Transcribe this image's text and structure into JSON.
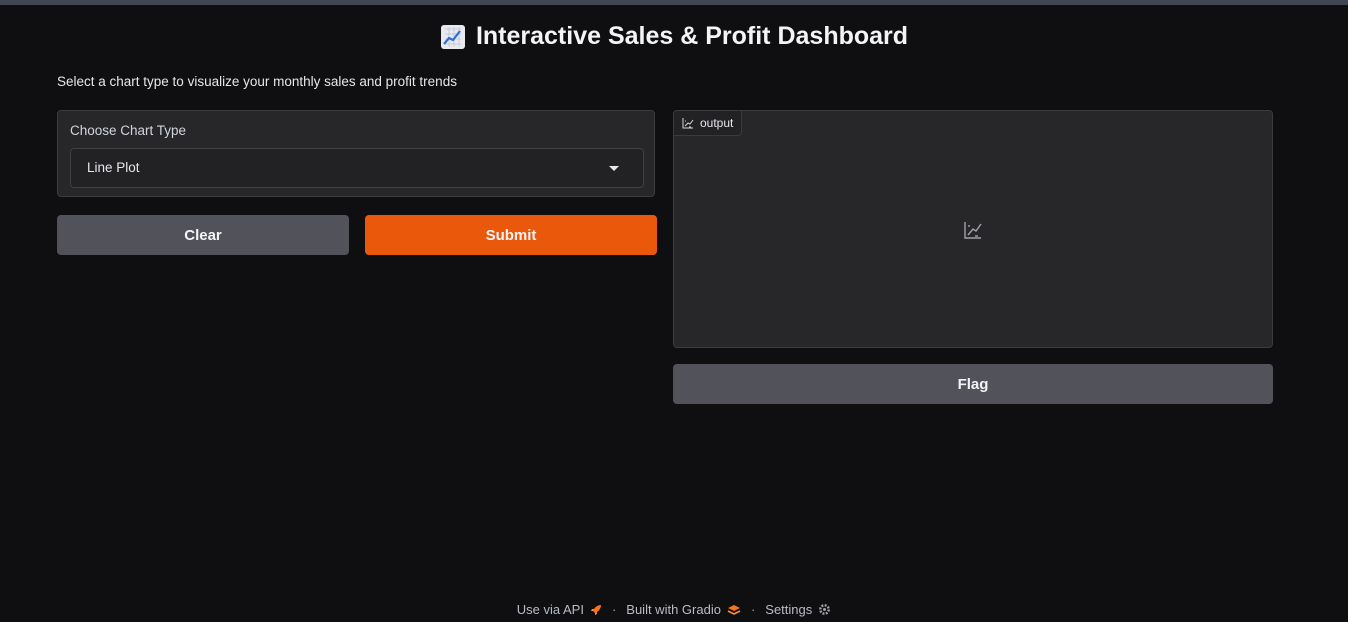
{
  "header": {
    "title": "Interactive Sales & Profit Dashboard",
    "title_icon": "chart-increasing-icon",
    "subtitle": "Select a chart type to visualize your monthly sales and profit trends"
  },
  "input_panel": {
    "label": "Choose Chart Type",
    "selected_value": "Line Plot"
  },
  "buttons": {
    "clear": "Clear",
    "submit": "Submit",
    "flag": "Flag"
  },
  "output": {
    "label": "output",
    "icon": "plot-icon"
  },
  "footer": {
    "api": "Use via API",
    "built_with": "Built with Gradio",
    "settings": "Settings",
    "separator": "·"
  },
  "colors": {
    "background": "#0f0f11",
    "panel": "#27272a",
    "primary_button": "#ea580c",
    "secondary_button": "#52525b"
  }
}
